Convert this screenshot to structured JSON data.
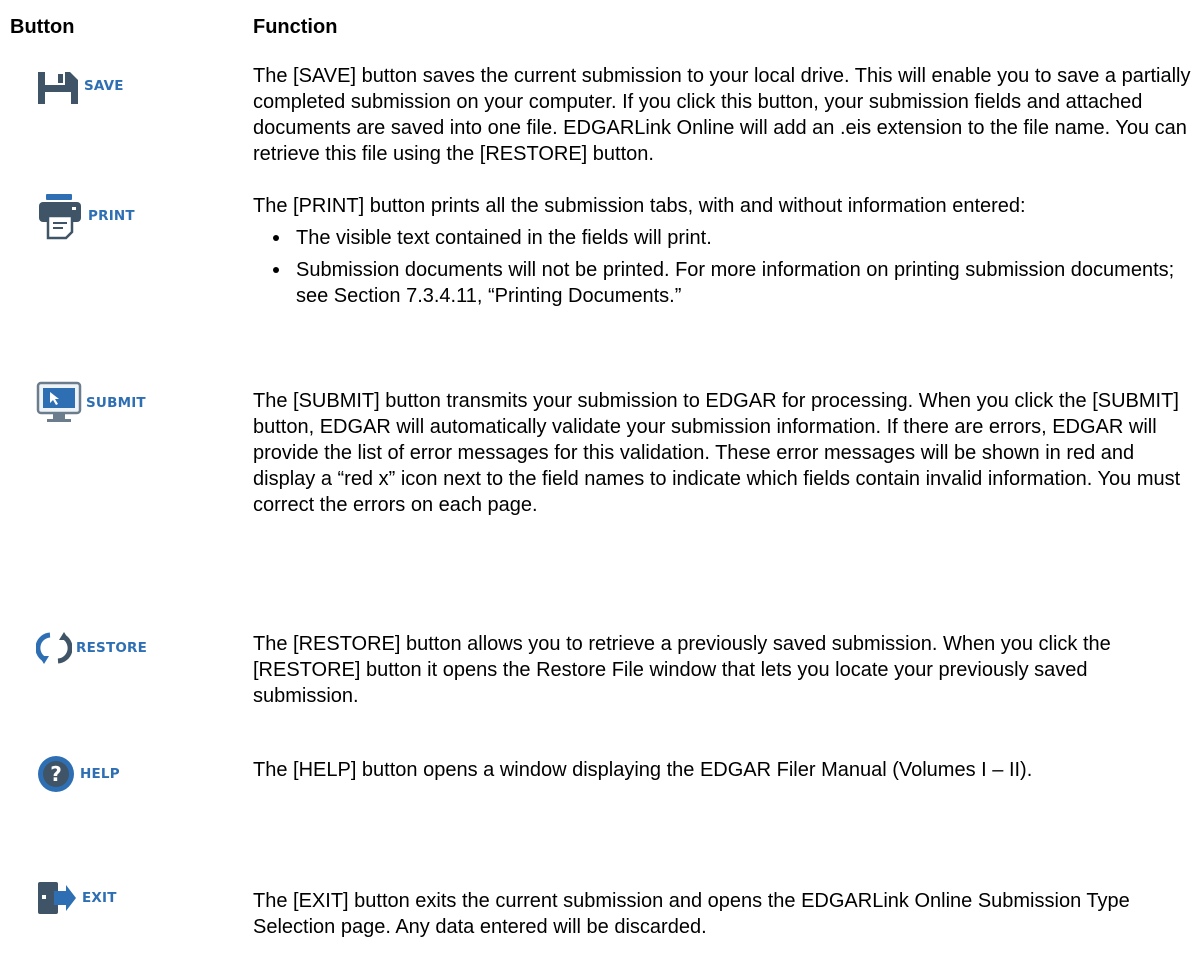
{
  "headers": {
    "button": "Button",
    "function": "Function"
  },
  "colors": {
    "icon_blue": "#2e6fb3",
    "icon_dark": "#3f5466",
    "icon_gray": "#6b7d8c"
  },
  "rows": [
    {
      "label": "SAVE",
      "icon": "floppy-disk-icon",
      "description": "The [SAVE] button saves the current submission to your local drive. This will enable you to save a partially completed submission on your computer. If you click this button, your submission fields and attached documents are saved into one file. EDGARLink Online will add an .eis extension to the file name. You can retrieve this file using the [RESTORE] button."
    },
    {
      "label": "PRINT",
      "icon": "printer-icon",
      "description": "The [PRINT] button prints all the submission tabs, with and without information entered:",
      "bullets": [
        "The visible text contained in the fields will print.",
        "Submission documents will not be printed. For more information on printing submission documents; see Section 7.3.4.11, “Printing Documents.”"
      ]
    },
    {
      "label": "SUBMIT",
      "icon": "monitor-cursor-icon",
      "description": "The [SUBMIT] button transmits your submission to EDGAR for processing. When you click the [SUBMIT] button, EDGAR will automatically validate your submission information. If there are errors, EDGAR will provide the list of error messages for this validation. These error messages will be shown in red and display a “red x” icon next to the field names to indicate which fields contain invalid information. You must correct the errors on each page."
    },
    {
      "label": "RESTORE",
      "icon": "refresh-arrows-icon",
      "description": "The [RESTORE] button allows you to retrieve a previously saved submission. When you click the [RESTORE] button it opens the Restore File window that lets you locate your previously saved submission."
    },
    {
      "label": "HELP",
      "icon": "question-mark-icon",
      "description": "The [HELP] button opens a window displaying the EDGAR Filer Manual (Volumes I – II)."
    },
    {
      "label": "EXIT",
      "icon": "exit-door-icon",
      "description": "The [EXIT] button exits the current submission and opens the EDGARLink Online Submission Type Selection page. Any data entered will be discarded."
    }
  ]
}
